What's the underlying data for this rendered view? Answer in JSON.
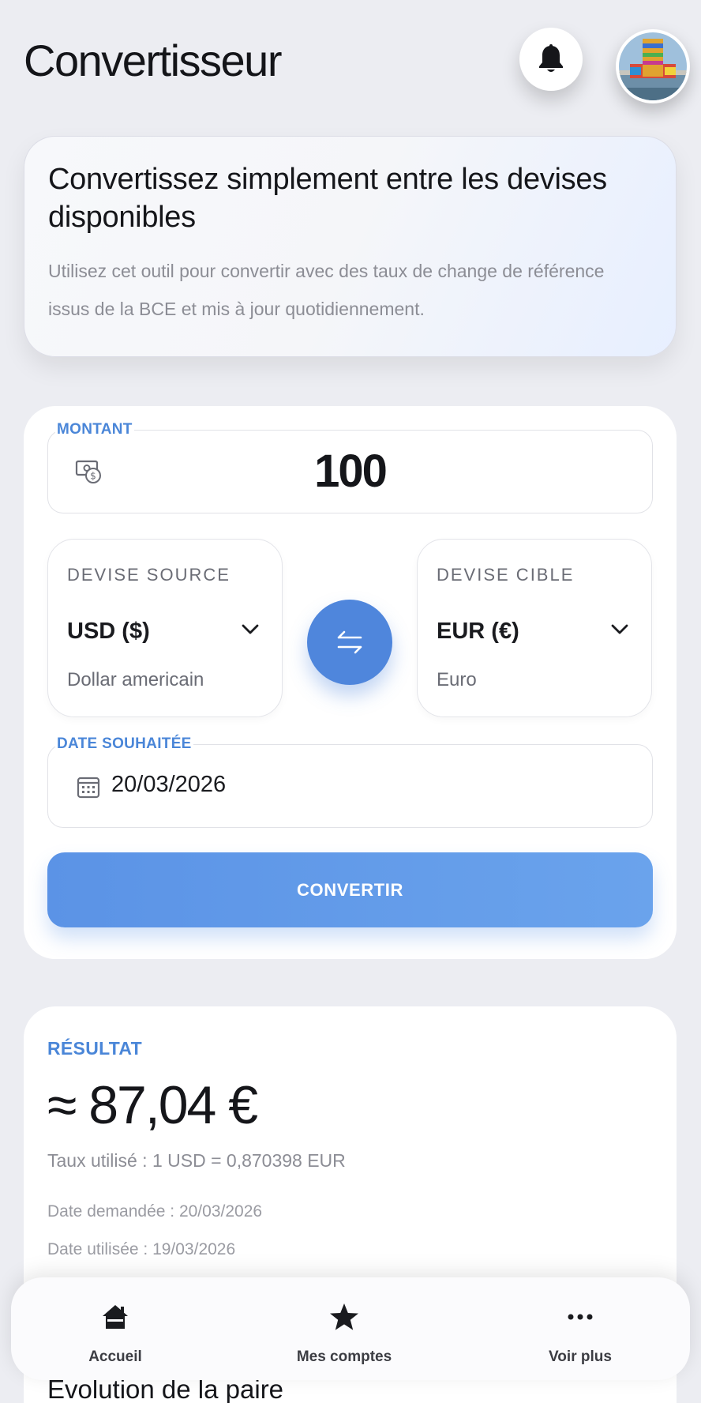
{
  "header": {
    "title": "Convertisseur",
    "bell_icon": "bell-icon",
    "avatar_alt": "avatar"
  },
  "intro": {
    "title": "Convertissez simplement entre les devises disponibles",
    "description": "Utilisez cet outil pour convertir avec des taux de change de référence issus de la BCE et mis à jour quotidiennement."
  },
  "form": {
    "amount_label": "MONTANT",
    "amount_value": "100",
    "source": {
      "label": "DEVISE SOURCE",
      "code": "USD ($)",
      "name": "Dollar americain"
    },
    "target": {
      "label": "DEVISE CIBLE",
      "code": "EUR (€)",
      "name": "Euro"
    },
    "date_label": "DATE SOUHAITÉE",
    "date_value": "20/03/2026",
    "convert_label": "CONVERTIR"
  },
  "result": {
    "label": "RÉSULTAT",
    "value": "≈ 87,04 €",
    "rate": "Taux utilisé : 1 USD = 0,870398 EUR",
    "requested_date": "Date demandée : 20/03/2026",
    "used_date": "Date utilisée : 19/03/2026",
    "evolution_title": "Évolution de la paire"
  },
  "nav": {
    "items": [
      {
        "label": "Accueil",
        "icon": "home-icon"
      },
      {
        "label": "Mes comptes",
        "icon": "star-icon"
      },
      {
        "label": "Voir plus",
        "icon": "more-icon"
      }
    ]
  },
  "colors": {
    "accent": "#4a86d8",
    "button": "#5b93e6",
    "background": "#ecedf2"
  }
}
